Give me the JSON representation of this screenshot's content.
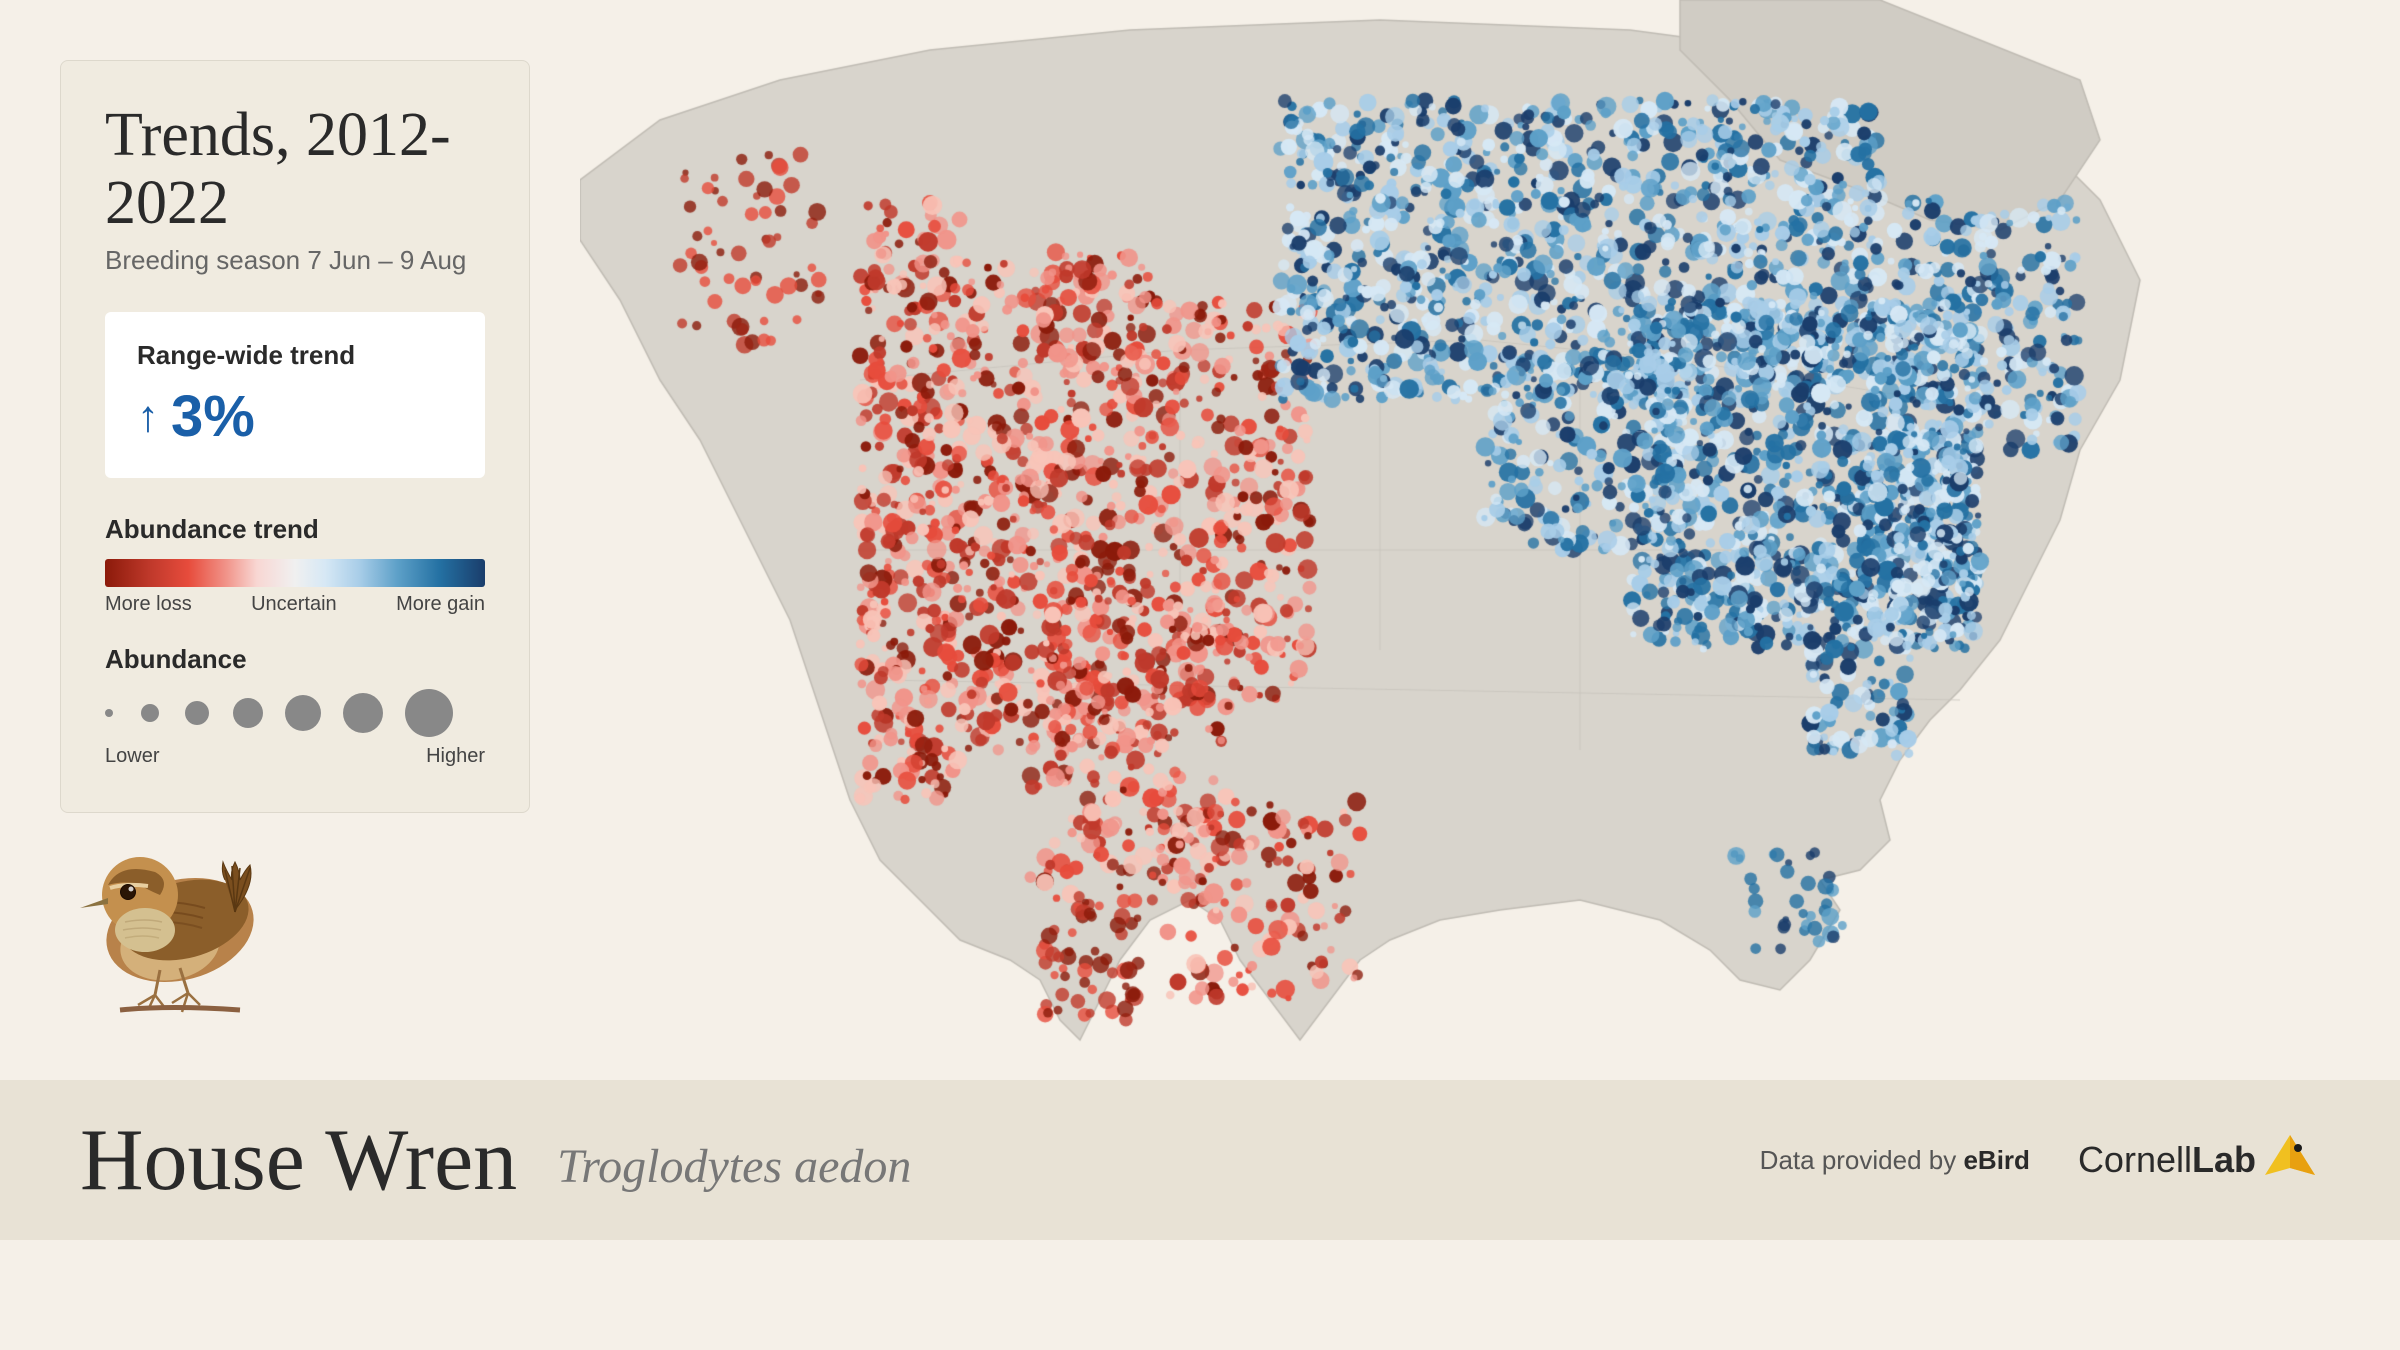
{
  "header": {
    "title": "Trends, 2012-2022",
    "subtitle": "Breeding season   7 Jun – 9 Aug"
  },
  "trend_box": {
    "label": "Range-wide trend",
    "value": "3%",
    "arrow": "↑"
  },
  "abundance_trend": {
    "label": "Abundance trend",
    "labels": {
      "left": "More loss",
      "center": "Uncertain",
      "right": "More gain"
    }
  },
  "abundance": {
    "label": "Abundance",
    "left_label": "Lower",
    "right_label": "Higher"
  },
  "footer": {
    "bird_name": "House Wren",
    "latin_name": "Troglodytes aedon",
    "credit": "Data provided by eBird",
    "lab": "CornellLab"
  },
  "colors": {
    "trend_blue": "#1a5fa8",
    "background": "#f5f0e8",
    "card_bg": "#f0ebe0",
    "footer_bg": "#e8e2d5"
  }
}
